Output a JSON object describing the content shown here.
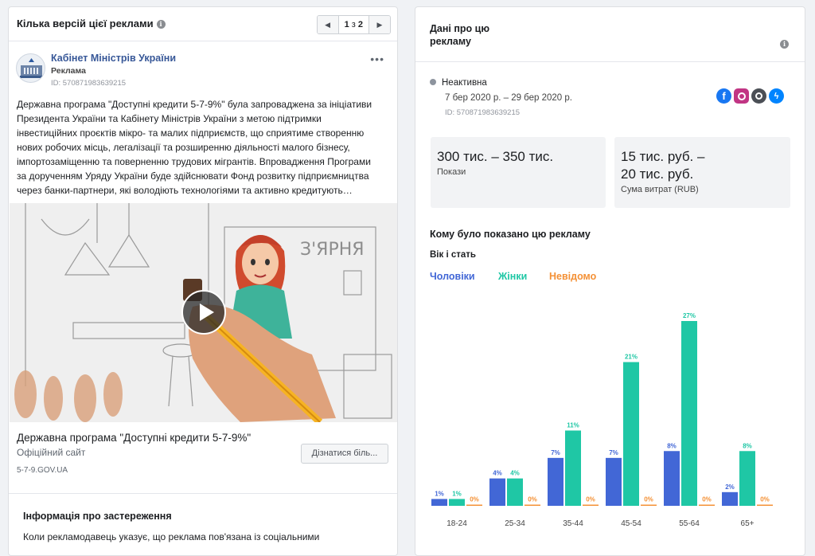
{
  "left": {
    "header_title": "Кілька версій цієї реклами",
    "pager": {
      "current": "1",
      "sep": "з",
      "total": "2"
    },
    "advertiser": {
      "name": "Кабінет Міністрів України",
      "type": "Реклама",
      "id": "ID: 570871983639215"
    },
    "more": "•••",
    "body_lines": [
      "Державна програма \"Доступні кредити 5-7-9%\" була запроваджена за ініціативи",
      "Президента України та Кабінету Міністрів України з метою підтримки",
      "інвестиційних проєктів мікро- та малих підприємств, що сприятиме створенню",
      "нових робочих місць, легалізації та розширенню діяльності малого бізнесу,",
      "імпортозаміщенню та поверненню трудових мігрантів. Впровадження Програми",
      "за дорученням Уряду України буде здійснювати Фонд розвитку підприємництва",
      "через банки-партнери, які володіють технологіями та активно кредитують…"
    ],
    "video_sign": "З'ЯРНЯ",
    "cta": {
      "title": "Державна програма \"Доступні кредити 5-7-9%\"",
      "subtitle": "Офіційний сайт",
      "url": "5-7-9.GOV.UA",
      "button": "Дізнатися біль..."
    },
    "disclaimer": {
      "title": "Інформація про застереження",
      "text": "Коли рекламодавець указує, що реклама пов'язана із соціальними"
    }
  },
  "right": {
    "header_title": "Дані про цю рекламу",
    "status": "Неактивна",
    "dates": "7 бер 2020 р. – 29 бер 2020 р.",
    "id": "ID: 570871983639215",
    "platform_icons": [
      "facebook-icon",
      "instagram-icon",
      "audience-network-icon",
      "messenger-icon"
    ],
    "impressions": {
      "value": "300 тис. – 350 тис.",
      "label": "Покази"
    },
    "spend": {
      "value_line1": "15 тис. руб. –",
      "value_line2": "20 тис. руб.",
      "label": "Сума витрат (RUB)"
    },
    "audience_title": "Кому було показано цю рекламу",
    "age_gender_title": "Вік і стать",
    "legend": {
      "men": "Чоловіки",
      "women": "Жінки",
      "unknown": "Невідомо"
    }
  },
  "colors": {
    "men": "#4267d6",
    "women": "#1fc7a5",
    "unknown": "#f49136",
    "link": "#385898"
  },
  "chart_data": {
    "type": "bar",
    "categories": [
      "18-24",
      "25-34",
      "35-44",
      "45-54",
      "55-64",
      "65+"
    ],
    "series": [
      {
        "name": "Чоловіки",
        "values": [
          1,
          4,
          7,
          7,
          8,
          2
        ]
      },
      {
        "name": "Жінки",
        "values": [
          1,
          4,
          11,
          21,
          27,
          8
        ]
      },
      {
        "name": "Невідомо",
        "values": [
          0,
          0,
          0,
          0,
          0,
          0
        ]
      }
    ],
    "value_suffix": "%",
    "ylim": [
      0,
      27
    ]
  }
}
